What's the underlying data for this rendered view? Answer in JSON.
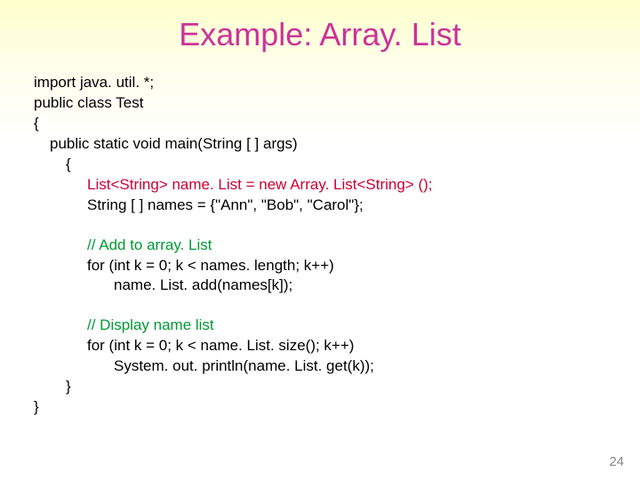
{
  "title": "Example: Array. List",
  "code": {
    "l1": "import java. util. *;",
    "l2": "public class Test",
    "l3": "{",
    "l4": "public  static void main(String [ ] args)",
    "l5": "{",
    "l6": "List<String> name. List = new Array. List<String> ();",
    "l7": "String [ ] names = {\"Ann\", \"Bob\", \"Carol\"};",
    "l8": "// Add to array. List",
    "l9": "for (int k = 0; k < names. length; k++)",
    "l10": "name. List. add(names[k]);",
    "l11": "// Display name list",
    "l12": "for (int k = 0; k < name. List. size(); k++)",
    "l13": "System. out. println(name. List. get(k));",
    "l14": "}",
    "l15": "}"
  },
  "pagenum": "24"
}
